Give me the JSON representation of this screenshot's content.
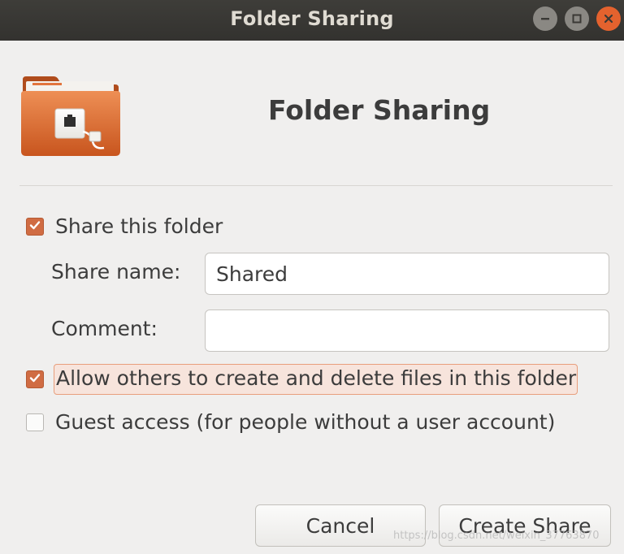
{
  "window": {
    "title": "Folder Sharing",
    "controls": [
      "minimize-icon",
      "maximize-icon",
      "close-icon"
    ]
  },
  "header": {
    "icon": "shared-folder-icon",
    "title": "Folder Sharing"
  },
  "options": {
    "share_folder": {
      "label": "Share this folder",
      "checked": true
    },
    "allow_others": {
      "label": "Allow others to create and delete files in this folder",
      "checked": true
    },
    "guest_access": {
      "label": "Guest access (for people without a user account)",
      "checked": false
    }
  },
  "form": {
    "share_name_label": "Share name:",
    "share_name_value": "Shared",
    "comment_label": "Comment:",
    "comment_value": ""
  },
  "buttons": {
    "cancel": "Cancel",
    "create": "Create Share"
  },
  "watermark": "https://blog.csdn.net/weixin_37763870",
  "colors": {
    "accent": "#d06c43",
    "titlebar": "#3a3935",
    "close_button": "#e4622e",
    "background": "#f0efee"
  }
}
